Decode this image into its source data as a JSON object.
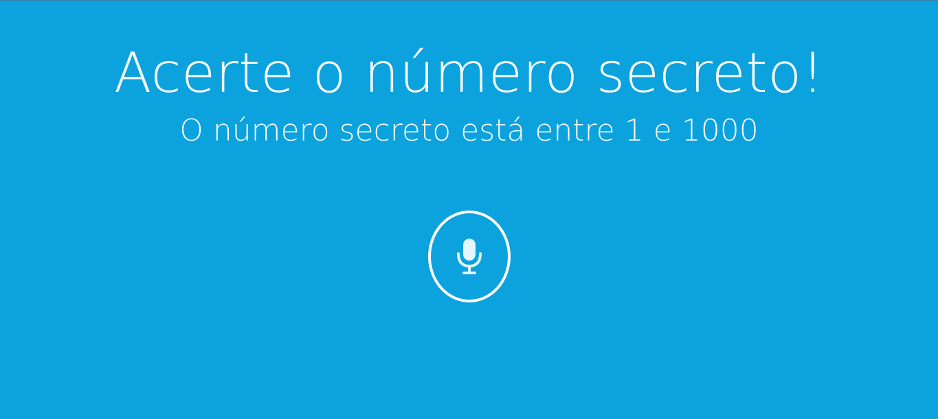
{
  "header": {
    "title": "Acerte o número secreto!",
    "subtitle": "O número secreto está entre 1 e 1000"
  },
  "controls": {
    "mic_icon": "microphone-icon"
  },
  "colors": {
    "background": "#0ba2dd",
    "foreground": "#ffffff",
    "icon_fill": "#e6f6ff"
  }
}
